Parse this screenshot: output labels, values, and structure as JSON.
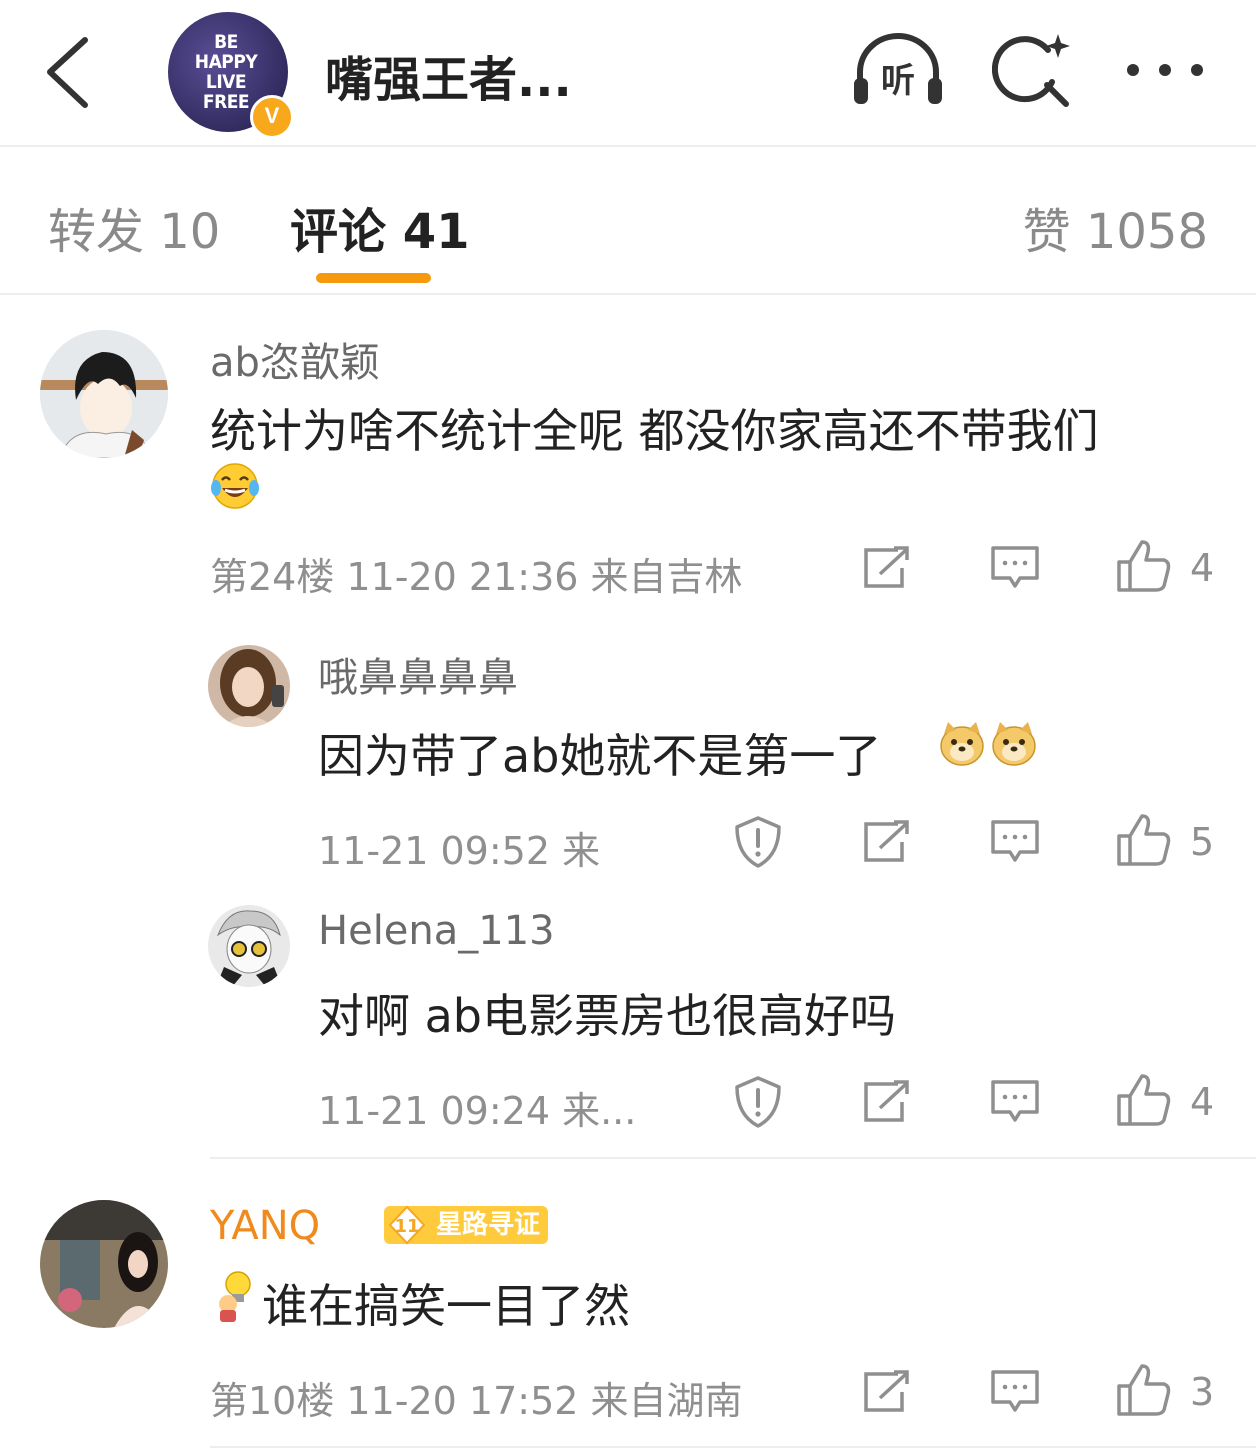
{
  "header": {
    "account_name": "嘴强王者...",
    "avatar_lines": [
      "BE",
      "HAPPY",
      "LIVE",
      "FREE"
    ],
    "verified_badge": "V",
    "listen_label": "听"
  },
  "tabs": [
    {
      "label": "转发 10"
    },
    {
      "label": "评论 41"
    },
    {
      "label": "赞 1058"
    }
  ],
  "comments": [
    {
      "username": "ab恣歆颖",
      "text": "统计为啥不统计全呢 都没你家高还不带我们",
      "emoji": "laughing-with-tears",
      "meta": "第24楼 11-20 21:36 来自吉林",
      "likes": "4"
    },
    {
      "username": "哦鼻鼻鼻鼻",
      "text": "因为带了ab她就不是第一了",
      "emoji": "doge",
      "meta": "11-21 09:52 来",
      "likes": "5"
    },
    {
      "username": "Helena_113",
      "text": "对啊 ab电影票房也很高好吗",
      "meta": "11-21 09:24 来...",
      "likes": "4"
    },
    {
      "username": "YANQ",
      "badge_level": "11",
      "badge_label": "星路寻证",
      "text": "谁在搞笑一目了然",
      "emoji": "lightbulb-head",
      "meta": "第10楼 11-20 17:52 来自湖南",
      "likes": "3"
    }
  ],
  "colors": {
    "accent_orange": "#f59a0c",
    "vip_yellow": "#ffcb3d",
    "vip_name_orange": "#f08a1c",
    "text_gray": "#8f8f8f"
  }
}
